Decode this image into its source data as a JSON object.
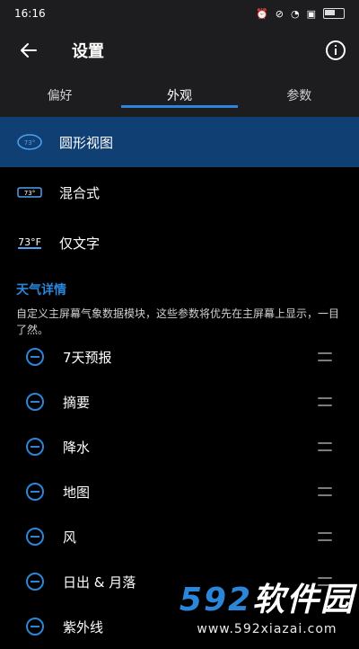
{
  "status": {
    "time": "16:16",
    "battery_level": 0.6
  },
  "appbar": {
    "title": "设置"
  },
  "tabs": [
    {
      "label": "偏好"
    },
    {
      "label": "外观"
    },
    {
      "label": "参数"
    }
  ],
  "options": [
    {
      "label": "圆形视图",
      "icon_text": "73°"
    },
    {
      "label": "混合式",
      "icon_text": "73°"
    },
    {
      "label": "仅文字",
      "icon_text": "73°F"
    }
  ],
  "details": {
    "title": "天气详情",
    "description": "自定义主屏幕气象数据模块，这些参数将优先在主屏幕上显示，一目了然。",
    "items": [
      {
        "label": "7天预报"
      },
      {
        "label": "摘要"
      },
      {
        "label": "降水"
      },
      {
        "label": "地图"
      },
      {
        "label": "风"
      },
      {
        "label": "日出 & 月落"
      },
      {
        "label": "紫外线"
      }
    ]
  },
  "watermark": {
    "main_num": "592",
    "main_text": "软件园",
    "url": "www.592xiazai.com"
  },
  "colors": {
    "accent": "#2b86d9",
    "selected": "#0f3f73",
    "bar": "#1d1d1f"
  }
}
